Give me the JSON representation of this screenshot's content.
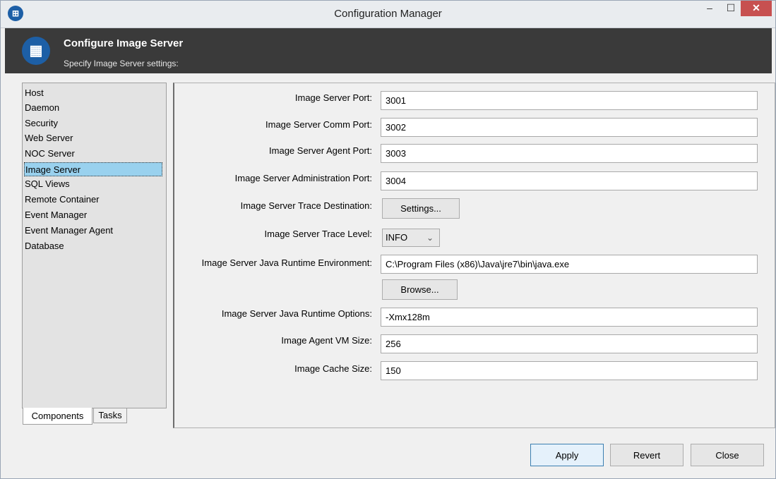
{
  "window": {
    "title": "Configuration Manager"
  },
  "header": {
    "title": "Configure Image Server",
    "subtitle": "Specify Image Server settings:"
  },
  "components": {
    "items": [
      "Host",
      "Daemon",
      "Security",
      "Web Server",
      "NOC Server",
      "Image Server",
      "SQL Views",
      "Remote Container",
      "Event Manager",
      "Event Manager Agent",
      "Database"
    ],
    "selected": "Image Server"
  },
  "tabs": {
    "components": "Components",
    "tasks": "Tasks"
  },
  "form": {
    "port_label": "Image Server Port:",
    "port_value": "3001",
    "comm_label": "Image Server Comm Port:",
    "comm_value": "3002",
    "agent_label": "Image Server Agent Port:",
    "agent_value": "3003",
    "admin_label": "Image Server Administration Port:",
    "admin_value": "3004",
    "trace_dest_label": "Image Server Trace Destination:",
    "trace_dest_button": "Settings...",
    "trace_level_label": "Image Server Trace Level:",
    "trace_level_value": "INFO",
    "jre_label": "Image Server Java Runtime Environment:",
    "jre_value": "C:\\Program Files (x86)\\Java\\jre7\\bin\\java.exe",
    "browse_button": "Browse...",
    "jre_options_label": "Image Server Java Runtime Options:",
    "jre_options_value": "-Xmx128m",
    "vm_size_label": "Image Agent VM Size:",
    "vm_size_value": "256",
    "cache_size_label": "Image Cache Size:",
    "cache_size_value": "150"
  },
  "buttons": {
    "apply": "Apply",
    "revert": "Revert",
    "close": "Close"
  },
  "icons": {
    "app": "building-icon",
    "min": "minimize-icon",
    "max": "maximize-icon",
    "close": "close-icon"
  },
  "colors": {
    "header_bg": "#3a3a3a",
    "selection": "#99d1ee",
    "close_button": "#c75050",
    "icon_blue": "#1d5fa6"
  }
}
